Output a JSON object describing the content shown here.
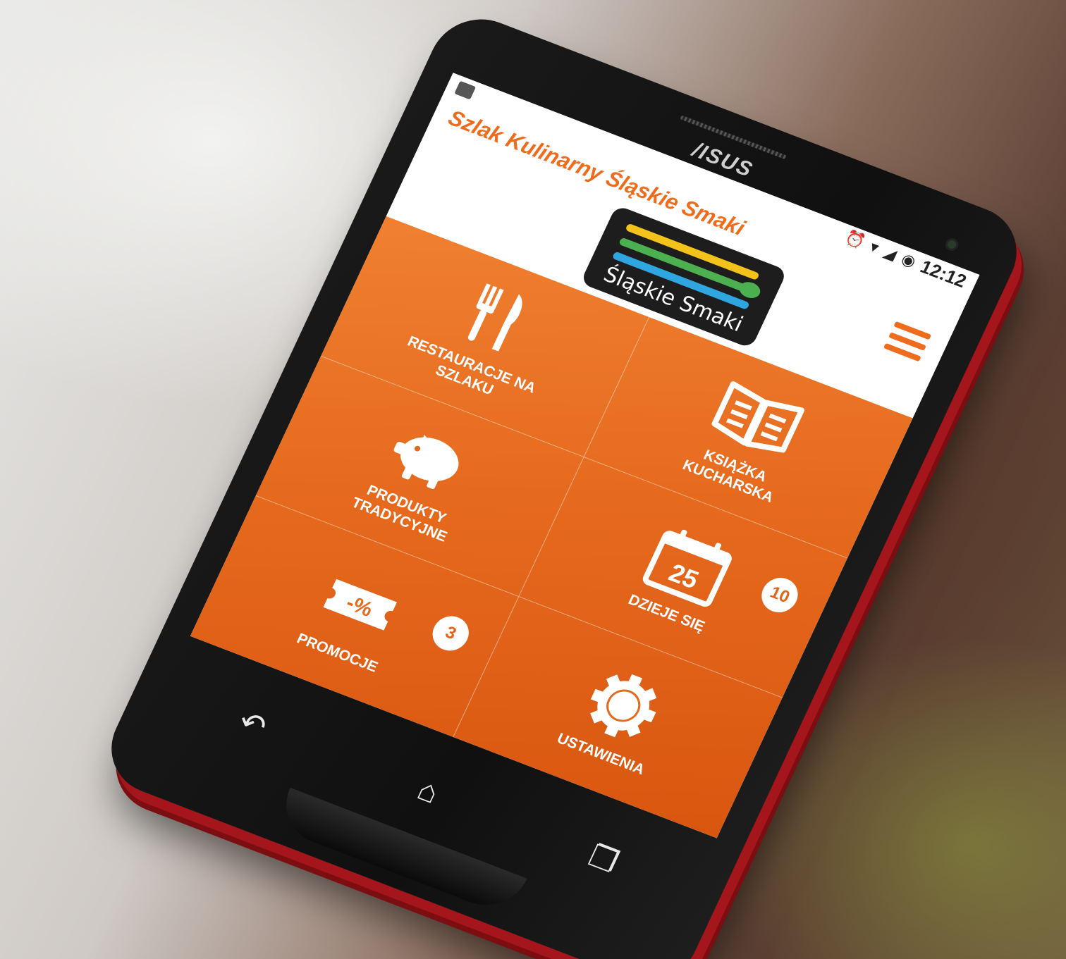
{
  "device": {
    "brand": "/ISUS"
  },
  "status_bar": {
    "time": "12:12",
    "icons": [
      "alarm-icon",
      "wifi-icon",
      "signal-icon",
      "battery-icon"
    ]
  },
  "app_bar": {
    "title": "Szlak Kulinarny Śląskie Smaki",
    "logo_text": "Śląskie Smaki",
    "menu_icon": "hamburger-menu-icon"
  },
  "tiles": [
    {
      "label": "RESTAURACJE NA SZLAKU",
      "icon": "cutlery-icon",
      "badge": ""
    },
    {
      "label": "KSIĄŻKA KUCHARSKA",
      "icon": "book-icon",
      "badge": ""
    },
    {
      "label": "PRODUKTY TRADYCYJNE",
      "icon": "piggy-bank-icon",
      "badge": ""
    },
    {
      "label": "DZIEJE SIĘ",
      "icon": "calendar-icon",
      "badge": "10",
      "calendar_day": "25"
    },
    {
      "label": "PROMOCJE",
      "icon": "discount-ticket-icon",
      "badge": "3",
      "ticket_text": "-%"
    },
    {
      "label": "USTAWIENIA",
      "icon": "gear-icon",
      "badge": ""
    }
  ],
  "nav_bar": {
    "back": "↶",
    "home": "⌂",
    "recents": "❐"
  },
  "colors": {
    "accent": "#ef6c1c",
    "tile_bg": "#e66a1e",
    "phone_trim": "#a5161c"
  }
}
